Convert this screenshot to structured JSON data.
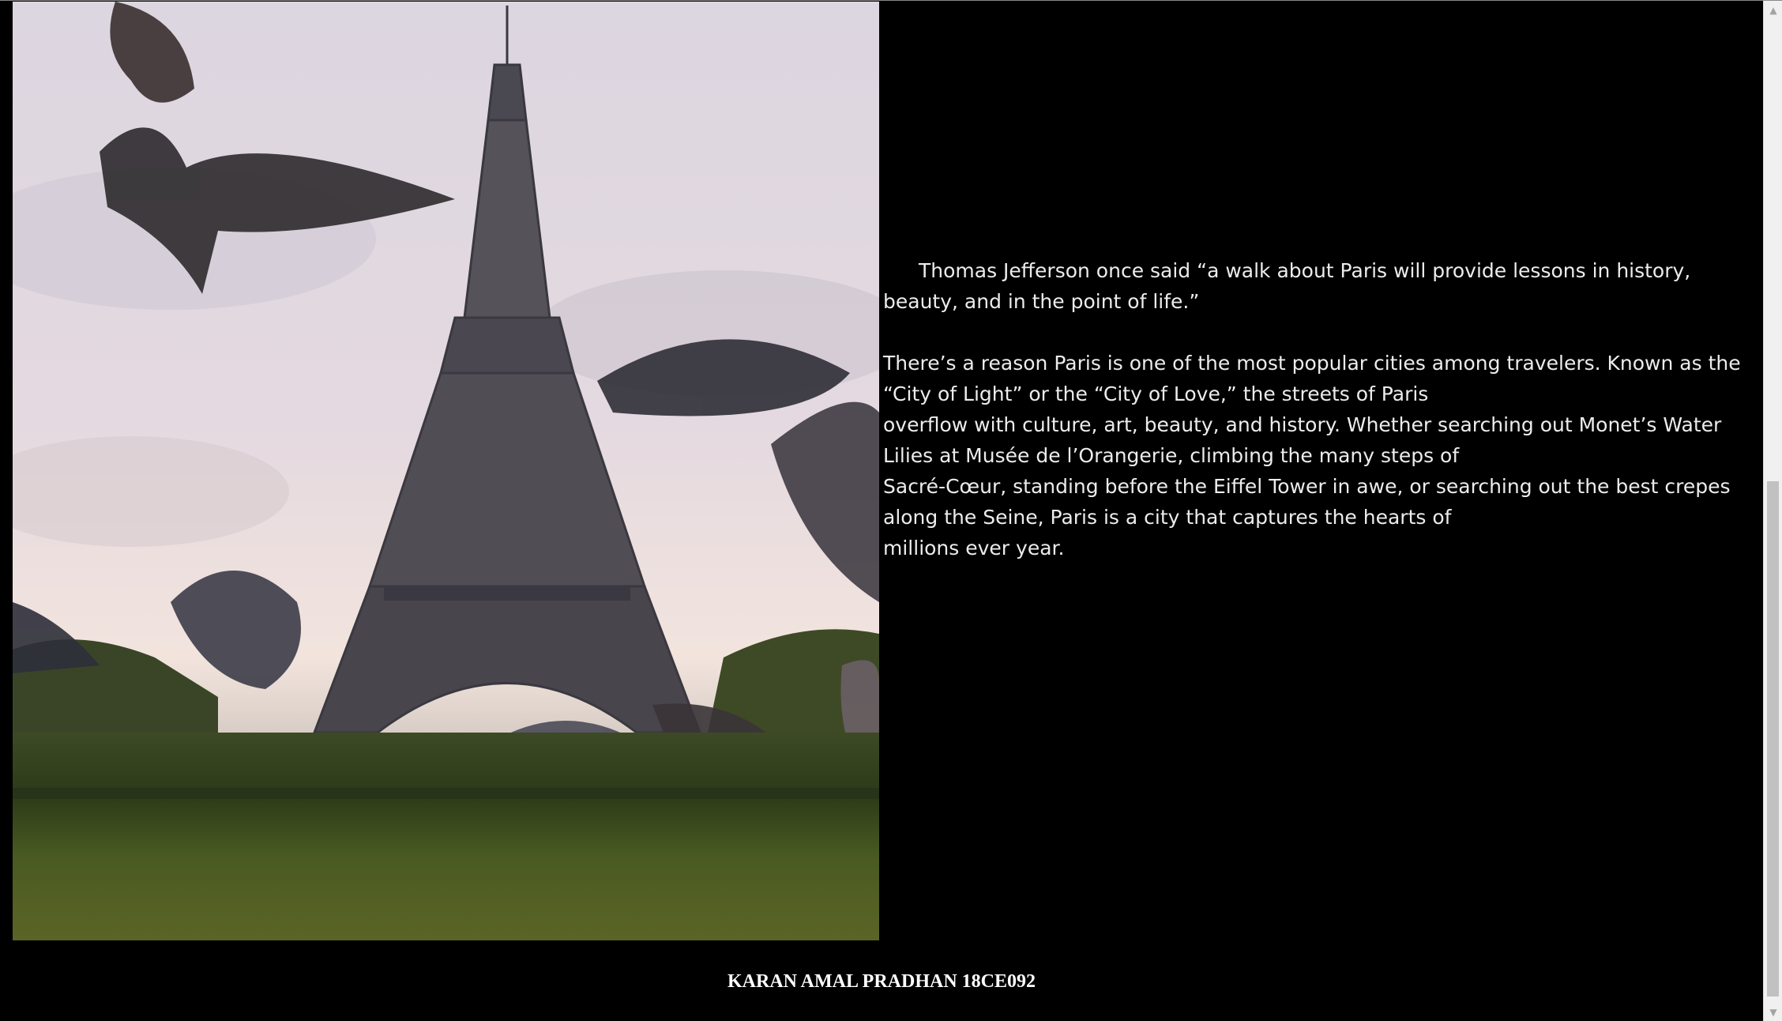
{
  "photo": {
    "alt": "Eiffel Tower with pigeons in flight on the lawn"
  },
  "article": {
    "quote": "Thomas Jefferson once said “a walk about Paris will provide lessons in history, beauty, and in the point of life.”",
    "body": "There’s a reason Paris is one of the most popular cities among travelers. Known as the “City of Light” or the “City of Love,” the streets of Paris\noverflow with culture, art, beauty, and history. Whether searching out Monet’s Water Lilies at Musée de l’Orangerie, climbing the many steps of\nSacré-Cœur, standing before the Eiffel Tower in awe, or searching out the best crepes along the Seine, Paris is a city that captures the hearts of\nmillions ever year."
  },
  "footer": {
    "text": "KARAN AMAL PRADHAN 18CE092"
  },
  "scrollbar": {
    "up_icon": "▲",
    "down_icon": "▼"
  },
  "colors": {
    "background": "#000000",
    "text": "#ececec",
    "scrollbar_track": "#f0f0f0",
    "scrollbar_thumb": "#c1c1c1"
  }
}
